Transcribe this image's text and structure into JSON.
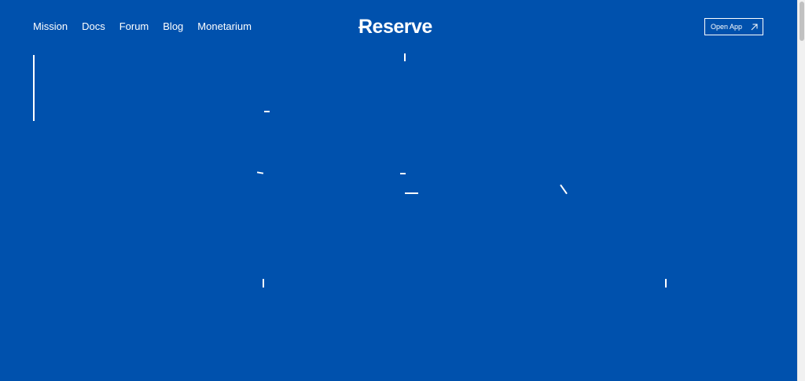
{
  "nav": {
    "items": [
      {
        "label": "Mission"
      },
      {
        "label": "Docs"
      },
      {
        "label": "Forum"
      },
      {
        "label": "Blog"
      },
      {
        "label": "Monetarium"
      }
    ]
  },
  "logo": {
    "text": "Reserve"
  },
  "header": {
    "open_app_label": "Open App",
    "open_app_icon": "arrow-up-right-icon"
  },
  "colors": {
    "background": "#0051ad",
    "foreground": "#ffffff"
  }
}
